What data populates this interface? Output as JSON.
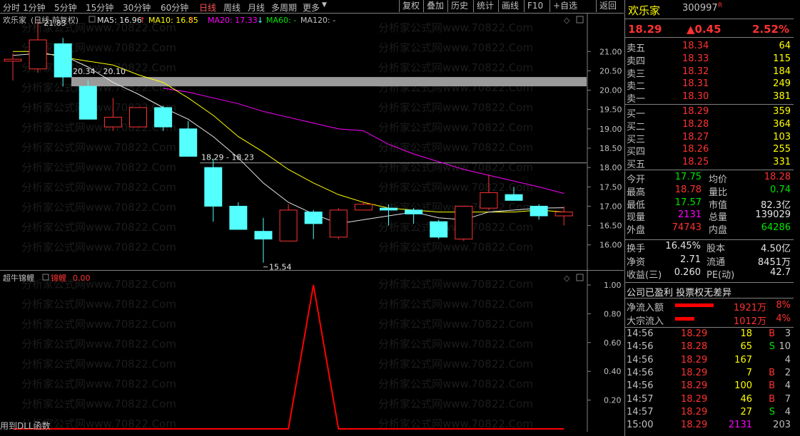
{
  "toolbar": {
    "periods": [
      "分时",
      "1分钟",
      "5分钟",
      "15分钟",
      "30分钟",
      "60分钟",
      "日线",
      "周线",
      "月线",
      "多周期",
      "更多"
    ],
    "active_period": "日线",
    "buttons": [
      "复权",
      "叠加",
      "历史",
      "统计",
      "画线",
      "F10",
      "+自选",
      "返回"
    ]
  },
  "chart_header": {
    "name": "欢乐家",
    "mode": "(日线 前复权)",
    "ma5": "MA5: 16.96",
    "ma10": "MA10: 16.85",
    "ma20": "MA20: 17.33",
    "ma60": "MA60: -",
    "ma120": "MA120: -"
  },
  "price_axis": [
    "21.00",
    "20.50",
    "20.00",
    "19.50",
    "19.00",
    "18.50",
    "18.00",
    "17.50",
    "17.00",
    "16.50",
    "16.00"
  ],
  "annotations": {
    "high": "21.83",
    "gap_label": "20.34 - 20.10",
    "mid_label": "18.29 - 18.23",
    "low": "15.54"
  },
  "indicator": {
    "name": "超牛锦鲤",
    "series_name": "锦鲤",
    "value": "0.00",
    "axis": [
      "1.00",
      "0.80",
      "0.60",
      "0.40",
      "0.20"
    ]
  },
  "status_text": "用到DLL函数",
  "watermark": "分析家公式网www.70822.Com",
  "colors": {
    "up": "#ff3232",
    "down": "#54ffff",
    "ma5": "#e6e6e6",
    "ma10": "#ffff00",
    "ma20": "#ff00ff",
    "ma60": "#00e600"
  },
  "chart_data": {
    "type": "candlestick",
    "candles": [
      {
        "o": 20.75,
        "h": 20.95,
        "l": 20.25,
        "c": 20.8
      },
      {
        "o": 20.55,
        "h": 21.83,
        "l": 20.45,
        "c": 21.3
      },
      {
        "o": 21.2,
        "h": 21.35,
        "l": 20.1,
        "c": 20.34
      },
      {
        "o": 20.1,
        "h": 20.25,
        "l": 19.25,
        "c": 19.25
      },
      {
        "o": 19.05,
        "h": 19.8,
        "l": 18.95,
        "c": 19.3
      },
      {
        "o": 19.05,
        "h": 19.55,
        "l": 19.05,
        "c": 19.55
      },
      {
        "o": 19.55,
        "h": 19.6,
        "l": 18.95,
        "c": 19.05
      },
      {
        "o": 19.0,
        "h": 19.2,
        "l": 18.29,
        "c": 18.29
      },
      {
        "o": 18.0,
        "h": 18.23,
        "l": 16.6,
        "c": 17.0
      },
      {
        "o": 17.0,
        "h": 17.1,
        "l": 16.4,
        "c": 16.4
      },
      {
        "o": 16.35,
        "h": 16.7,
        "l": 15.54,
        "c": 16.15
      },
      {
        "o": 16.1,
        "h": 17.05,
        "l": 16.1,
        "c": 16.9
      },
      {
        "o": 16.85,
        "h": 16.9,
        "l": 16.15,
        "c": 16.55
      },
      {
        "o": 16.2,
        "h": 16.95,
        "l": 16.15,
        "c": 16.9
      },
      {
        "o": 16.9,
        "h": 17.1,
        "l": 16.9,
        "c": 17.05
      },
      {
        "o": 16.95,
        "h": 17.05,
        "l": 16.5,
        "c": 16.9
      },
      {
        "o": 16.9,
        "h": 16.95,
        "l": 16.55,
        "c": 16.8
      },
      {
        "o": 16.6,
        "h": 16.65,
        "l": 16.15,
        "c": 16.2
      },
      {
        "o": 16.15,
        "h": 17.0,
        "l": 16.1,
        "c": 17.0
      },
      {
        "o": 16.95,
        "h": 17.82,
        "l": 16.9,
        "c": 17.35
      },
      {
        "o": 17.3,
        "h": 17.5,
        "l": 17.15,
        "c": 17.15
      },
      {
        "o": 17.0,
        "h": 17.05,
        "l": 16.65,
        "c": 16.75
      },
      {
        "o": 16.75,
        "h": 17.0,
        "l": 16.5,
        "c": 16.85
      }
    ],
    "ma5": [
      20.9,
      20.95,
      20.9,
      20.6,
      20.2,
      19.9,
      19.55,
      19.25,
      18.8,
      18.25,
      17.6,
      17.1,
      16.8,
      16.55,
      16.65,
      16.75,
      16.85,
      16.7,
      16.65,
      16.85,
      16.9,
      16.95,
      16.96
    ],
    "ma10": [
      21.0,
      21.0,
      20.85,
      20.75,
      20.65,
      20.4,
      20.2,
      19.8,
      19.35,
      18.8,
      18.4,
      17.95,
      17.6,
      17.3,
      17.1,
      16.95,
      16.9,
      16.85,
      16.85,
      16.85,
      16.85,
      16.9,
      16.85
    ],
    "ma20": [
      null,
      null,
      null,
      null,
      null,
      null,
      20.05,
      19.95,
      19.8,
      19.65,
      19.45,
      19.3,
      19.15,
      19.0,
      18.95,
      18.6,
      18.35,
      18.15,
      17.95,
      17.8,
      17.65,
      17.5,
      17.33
    ],
    "gap_band": [
      20.1,
      20.34
    ],
    "ref_line": 18.23,
    "ylim": [
      15.7,
      22.0
    ],
    "indicator_values": [
      0,
      0,
      0,
      0,
      0,
      0,
      0,
      0,
      0,
      0,
      0,
      0,
      1,
      0,
      0,
      0,
      0,
      0,
      0,
      0,
      0,
      0,
      0
    ],
    "indicator_ylim": [
      0,
      1.0
    ]
  },
  "stock": {
    "name": "欢乐家",
    "code": "300997",
    "flag": "R",
    "price": "18.29",
    "change": "▲0.45",
    "pct": "2.52%"
  },
  "order_book": {
    "sell": [
      {
        "label": "卖五",
        "price": "18.34",
        "vol": "64"
      },
      {
        "label": "卖四",
        "price": "18.33",
        "vol": "115"
      },
      {
        "label": "卖三",
        "price": "18.32",
        "vol": "184"
      },
      {
        "label": "卖二",
        "price": "18.31",
        "vol": "249"
      },
      {
        "label": "卖一",
        "price": "18.30",
        "vol": "381"
      }
    ],
    "buy": [
      {
        "label": "买一",
        "price": "18.29",
        "vol": "359"
      },
      {
        "label": "买二",
        "price": "18.28",
        "vol": "364"
      },
      {
        "label": "买三",
        "price": "18.27",
        "vol": "103"
      },
      {
        "label": "买四",
        "price": "18.26",
        "vol": "255"
      },
      {
        "label": "买五",
        "price": "18.25",
        "vol": "331"
      }
    ]
  },
  "quote": [
    {
      "l1": "今开",
      "v1": "17.75",
      "c1": "green",
      "l2": "均价",
      "v2": "18.28",
      "c2": "red"
    },
    {
      "l1": "最高",
      "v1": "18.78",
      "c1": "red",
      "l2": "量比",
      "v2": "0.74",
      "c2": "green"
    },
    {
      "l1": "最低",
      "v1": "17.57",
      "c1": "green",
      "l2": "市值",
      "v2": "82.3亿",
      "c2": "white"
    },
    {
      "l1": "现量",
      "v1": "2131",
      "c1": "magenta",
      "l2": "总量",
      "v2": "139029",
      "c2": "white"
    },
    {
      "l1": "外盘",
      "v1": "74743",
      "c1": "red",
      "l2": "内盘",
      "v2": "64286",
      "c2": "green"
    }
  ],
  "fundamentals": [
    {
      "l1": "换手",
      "v1": "16.45%",
      "l2": "股本",
      "v2": "4.50亿"
    },
    {
      "l1": "净资",
      "v1": "2.71",
      "l2": "流通",
      "v2": "8451万"
    },
    {
      "l1": "收益(三)",
      "v1": "0.260",
      "l2": "PE(动)",
      "v2": "42.7"
    }
  ],
  "notice": "公司已盈利 投票权无差异",
  "flows": [
    {
      "label": "净流入额",
      "value": "1921万",
      "pct": "8%",
      "bar": 0.8
    },
    {
      "label": "大宗流入",
      "value": "1012万",
      "pct": "4%",
      "bar": 0.4
    }
  ],
  "ticks": [
    {
      "time": "14:56",
      "price": "18.29",
      "vol": "18",
      "side": "B",
      "n": "3"
    },
    {
      "time": "14:56",
      "price": "18.28",
      "vol": "65",
      "side": "S",
      "n": "10"
    },
    {
      "time": "14:56",
      "price": "18.29",
      "vol": "167",
      "side": "",
      "n": "4"
    },
    {
      "time": "14:56",
      "price": "18.29",
      "vol": "7",
      "side": "B",
      "n": "2"
    },
    {
      "time": "14:56",
      "price": "18.29",
      "vol": "100",
      "side": "B",
      "n": "4"
    },
    {
      "time": "14:57",
      "price": "18.29",
      "vol": "46",
      "side": "B",
      "n": "7"
    },
    {
      "time": "14:57",
      "price": "18.29",
      "vol": "27",
      "side": "S",
      "n": "4"
    },
    {
      "time": "15:00",
      "price": "18.29",
      "vol": "2131",
      "side": "",
      "n": "203"
    }
  ]
}
